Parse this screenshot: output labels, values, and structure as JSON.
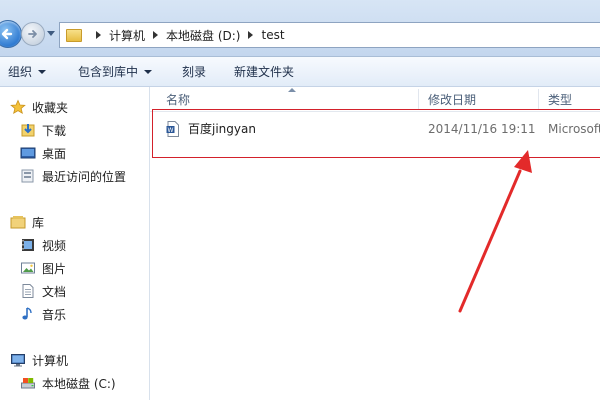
{
  "address_bar": {
    "crumbs": [
      "计算机",
      "本地磁盘 (D:)",
      "test"
    ]
  },
  "toolbar": {
    "organize": "组织",
    "include_in_library": "包含到库中",
    "burn": "刻录",
    "new_folder": "新建文件夹"
  },
  "sidebar": {
    "favorites": "收藏夹",
    "downloads": "下载",
    "desktop": "桌面",
    "recent": "最近访问的位置",
    "libraries": "库",
    "videos": "视频",
    "pictures": "图片",
    "documents": "文档",
    "music": "音乐",
    "computer": "计算机",
    "local_disk_c": "本地磁盘 (C:)"
  },
  "columns": {
    "name": "名称",
    "modified": "修改日期",
    "type": "类型"
  },
  "files": [
    {
      "name": "百度jingyan",
      "modified": "2014/11/16 19:11",
      "type": "Microsoft"
    }
  ],
  "colors": {
    "annotation": "#d3212b",
    "nav_accent": "#2f7ad1"
  },
  "icons": [
    "back-arrow-icon",
    "forward-arrow-icon",
    "folder-icon",
    "star-icon",
    "download-icon",
    "desktop-icon",
    "recent-places-icon",
    "library-icon",
    "video-icon",
    "picture-icon",
    "document-icon",
    "music-icon",
    "computer-icon",
    "drive-icon",
    "word-doc-icon"
  ]
}
